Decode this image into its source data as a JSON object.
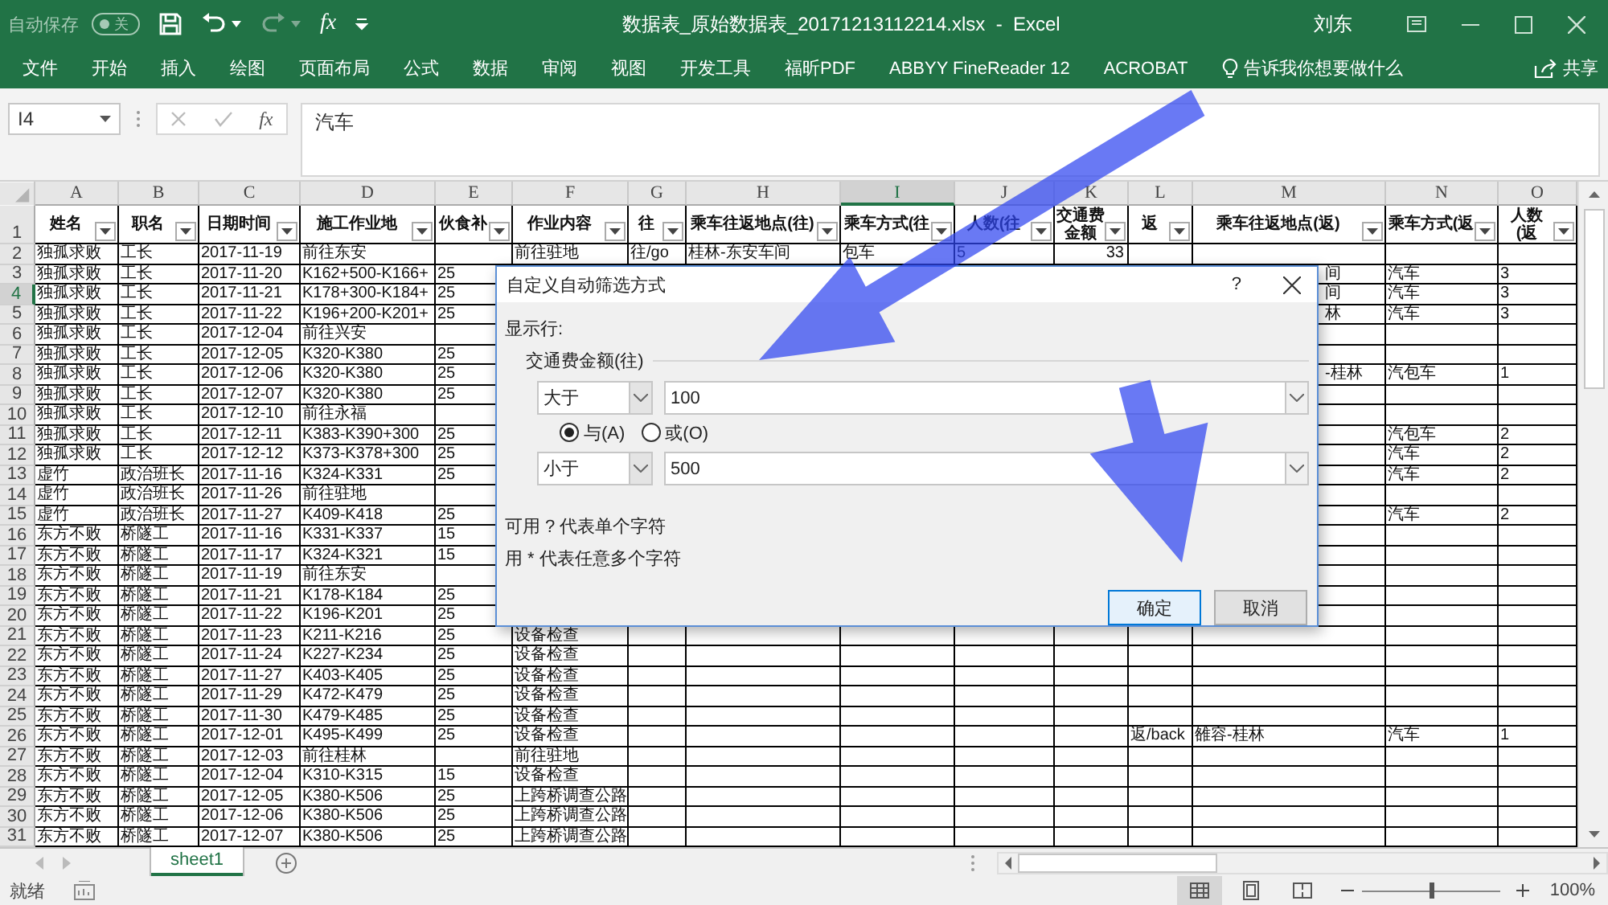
{
  "title_bar": {
    "autosave_label": "自动保存",
    "autosave_toggle": {
      "label": "关",
      "on": false
    },
    "function_symbol": "fx",
    "document_title": "数据表_原始数据表_20171213112214.xlsx  -  Excel",
    "user": "刘东"
  },
  "ribbon_tabs": [
    {
      "label": "文件",
      "selected": false
    },
    {
      "label": "开始",
      "selected": false
    },
    {
      "label": "插入",
      "selected": false
    },
    {
      "label": "绘图",
      "selected": false
    },
    {
      "label": "页面布局",
      "selected": false
    },
    {
      "label": "公式",
      "selected": false
    },
    {
      "label": "数据",
      "selected": false
    },
    {
      "label": "审阅",
      "selected": false
    },
    {
      "label": "视图",
      "selected": false
    },
    {
      "label": "开发工具",
      "selected": false
    },
    {
      "label": "福昕PDF",
      "selected": false
    },
    {
      "label": "ABBYY FineReader 12",
      "selected": false
    },
    {
      "label": "ACROBAT",
      "selected": false
    }
  ],
  "tell_me": "告诉我你想要做什么",
  "share": "共享",
  "formula_bar": {
    "name_box": "I4",
    "function_symbol": "fx",
    "value": "汽车"
  },
  "columns": [
    {
      "label": "A",
      "selected": false
    },
    {
      "label": "B",
      "selected": false
    },
    {
      "label": "C",
      "selected": false
    },
    {
      "label": "D",
      "selected": false
    },
    {
      "label": "E",
      "selected": false
    },
    {
      "label": "F",
      "selected": false
    },
    {
      "label": "G",
      "selected": false
    },
    {
      "label": "H",
      "selected": false
    },
    {
      "label": "I",
      "selected": true
    },
    {
      "label": "J",
      "selected": false
    },
    {
      "label": "K",
      "selected": false
    },
    {
      "label": "L",
      "selected": false
    },
    {
      "label": "M",
      "selected": false
    },
    {
      "label": "N",
      "selected": false
    },
    {
      "label": "O",
      "selected": false
    }
  ],
  "header_row": {
    "row": "1",
    "selected": false,
    "cells": {
      "A": "姓名",
      "B": "职名",
      "C": "日期时间",
      "D": "施工作业地",
      "E": "伙食补",
      "F": "作业内容",
      "G": "往",
      "H": "乘车往返地点(往)",
      "I": "乘车方式(往",
      "J": "人数(往",
      "K": "交通费金额",
      "L": "返",
      "M": "乘车往返地点(返)",
      "N": "乘车方式(返",
      "O": "人数(返"
    }
  },
  "rows": [
    {
      "row": "2",
      "selected": false,
      "cells": {
        "A": "独孤求败",
        "B": "工长",
        "C": "2017-11-19",
        "D": "前往东安",
        "F": "前往驻地",
        "G": "往/go",
        "H": "桂林-东安车间",
        "I": "包车",
        "J": "5",
        "K": "33"
      }
    },
    {
      "row": "3",
      "selected": false,
      "cells": {
        "A": "独孤求败",
        "B": "工长",
        "C": "2017-11-20",
        "D": "K162+500-K166+",
        "E": "25",
        "M": {
          "text": "间",
          "cut": true
        },
        "N": "汽车",
        "O": "3"
      }
    },
    {
      "row": "4",
      "selected": true,
      "cells": {
        "A": "独孤求败",
        "B": "工长",
        "C": "2017-11-21",
        "D": "K178+300-K184+",
        "E": "25",
        "M": {
          "text": "间",
          "cut": true
        },
        "N": "汽车",
        "O": "3"
      }
    },
    {
      "row": "5",
      "selected": false,
      "cells": {
        "A": "独孤求败",
        "B": "工长",
        "C": "2017-11-22",
        "D": "K196+200-K201+",
        "E": "25",
        "M": {
          "text": "林",
          "cut": true
        },
        "N": "汽车",
        "O": "3"
      }
    },
    {
      "row": "6",
      "selected": false,
      "cells": {
        "A": "独孤求败",
        "B": "工长",
        "C": "2017-12-04",
        "D": "前往兴安"
      }
    },
    {
      "row": "7",
      "selected": false,
      "cells": {
        "A": "独孤求败",
        "B": "工长",
        "C": "2017-12-05",
        "D": "K320-K380",
        "E": "25"
      }
    },
    {
      "row": "8",
      "selected": false,
      "cells": {
        "A": "独孤求败",
        "B": "工长",
        "C": "2017-12-06",
        "D": "K320-K380",
        "E": "25",
        "M": {
          "text": "-桂林",
          "cut": true
        },
        "N": "汽包车",
        "O": "1"
      }
    },
    {
      "row": "9",
      "selected": false,
      "cells": {
        "A": "独孤求败",
        "B": "工长",
        "C": "2017-12-07",
        "D": "K320-K380",
        "E": "25"
      }
    },
    {
      "row": "10",
      "selected": false,
      "cells": {
        "A": "独孤求败",
        "B": "工长",
        "C": "2017-12-10",
        "D": "前往永福"
      }
    },
    {
      "row": "11",
      "selected": false,
      "cells": {
        "A": "独孤求败",
        "B": "工长",
        "C": "2017-12-11",
        "D": "K383-K390+300",
        "E": "25",
        "N": "汽包车",
        "O": "2"
      }
    },
    {
      "row": "12",
      "selected": false,
      "cells": {
        "A": "独孤求败",
        "B": "工长",
        "C": "2017-12-12",
        "D": "K373-K378+300",
        "E": "25",
        "N": "汽车",
        "O": "2"
      }
    },
    {
      "row": "13",
      "selected": false,
      "cells": {
        "A": "虚竹",
        "B": "政治班长",
        "C": "2017-11-16",
        "D": "K324-K331",
        "E": "25",
        "N": "汽车",
        "O": "2"
      }
    },
    {
      "row": "14",
      "selected": false,
      "cells": {
        "A": "虚竹",
        "B": "政治班长",
        "C": "2017-11-26",
        "D": "前往驻地"
      }
    },
    {
      "row": "15",
      "selected": false,
      "cells": {
        "A": "虚竹",
        "B": "政治班长",
        "C": "2017-11-27",
        "D": "K409-K418",
        "E": "25",
        "N": "汽车",
        "O": "2"
      }
    },
    {
      "row": "16",
      "selected": false,
      "cells": {
        "A": "东方不败",
        "B": "桥隧工",
        "C": "2017-11-16",
        "D": "K331-K337",
        "E": "15"
      }
    },
    {
      "row": "17",
      "selected": false,
      "cells": {
        "A": "东方不败",
        "B": "桥隧工",
        "C": "2017-11-17",
        "D": "K324-K321",
        "E": "15"
      }
    },
    {
      "row": "18",
      "selected": false,
      "cells": {
        "A": "东方不败",
        "B": "桥隧工",
        "C": "2017-11-19",
        "D": "前往东安"
      }
    },
    {
      "row": "19",
      "selected": false,
      "cells": {
        "A": "东方不败",
        "B": "桥隧工",
        "C": "2017-11-21",
        "D": "K178-K184",
        "E": "25"
      }
    },
    {
      "row": "20",
      "selected": false,
      "cells": {
        "A": "东方不败",
        "B": "桥隧工",
        "C": "2017-11-22",
        "D": "K196-K201",
        "E": "25"
      }
    },
    {
      "row": "21",
      "selected": false,
      "cells": {
        "A": "东方不败",
        "B": "桥隧工",
        "C": "2017-11-23",
        "D": "K211-K216",
        "E": "25",
        "F": "设备检查"
      }
    },
    {
      "row": "22",
      "selected": false,
      "cells": {
        "A": "东方不败",
        "B": "桥隧工",
        "C": "2017-11-24",
        "D": "K227-K234",
        "E": "25",
        "F": "设备检查"
      }
    },
    {
      "row": "23",
      "selected": false,
      "cells": {
        "A": "东方不败",
        "B": "桥隧工",
        "C": "2017-11-27",
        "D": "K403-K405",
        "E": "25",
        "F": "设备检查"
      }
    },
    {
      "row": "24",
      "selected": false,
      "cells": {
        "A": "东方不败",
        "B": "桥隧工",
        "C": "2017-11-29",
        "D": "K472-K479",
        "E": "25",
        "F": "设备检查"
      }
    },
    {
      "row": "25",
      "selected": false,
      "cells": {
        "A": "东方不败",
        "B": "桥隧工",
        "C": "2017-11-30",
        "D": "K479-K485",
        "E": "25",
        "F": "设备检查"
      }
    },
    {
      "row": "26",
      "selected": false,
      "cells": {
        "A": "东方不败",
        "B": "桥隧工",
        "C": "2017-12-01",
        "D": "K495-K499",
        "E": "25",
        "F": "设备检查",
        "L": "返/back",
        "M": "雒容-桂林",
        "N": "汽车",
        "O": "1"
      }
    },
    {
      "row": "27",
      "selected": false,
      "cells": {
        "A": "东方不败",
        "B": "桥隧工",
        "C": "2017-12-03",
        "D": "前往桂林",
        "F": "前往驻地"
      }
    },
    {
      "row": "28",
      "selected": false,
      "cells": {
        "A": "东方不败",
        "B": "桥隧工",
        "C": "2017-12-04",
        "D": "K310-K315",
        "E": "15",
        "F": "设备检查"
      }
    },
    {
      "row": "29",
      "selected": false,
      "cells": {
        "A": "东方不败",
        "B": "桥隧工",
        "C": "2017-12-05",
        "D": "K380-K506",
        "E": "25",
        "F": "上跨桥调查公路"
      }
    },
    {
      "row": "30",
      "selected": false,
      "cells": {
        "A": "东方不败",
        "B": "桥隧工",
        "C": "2017-12-06",
        "D": "K380-K506",
        "E": "25",
        "F": "上跨桥调查公路"
      }
    },
    {
      "row": "31",
      "selected": false,
      "cells": {
        "A": "东方不败",
        "B": "桥隧工",
        "C": "2017-12-07",
        "D": "K380-K506",
        "E": "25",
        "F": "上跨桥调查公路"
      }
    }
  ],
  "sheet_tabs": [
    {
      "label": "sheet1",
      "selected": true
    }
  ],
  "dialog": {
    "title": "自定义自动筛选方式",
    "help": "?",
    "show_rows_label": "显示行:",
    "field_label": "交通费金额(往)",
    "conditions": [
      {
        "operator": "大于",
        "value": "100"
      },
      {
        "operator": "小于",
        "value": "500"
      }
    ],
    "logic": [
      {
        "label": "与(A)",
        "selected": true
      },
      {
        "label": "或(O)",
        "selected": false
      }
    ],
    "hints": [
      "可用 ? 代表单个字符",
      "用 * 代表任意多个字符"
    ],
    "buttons": [
      {
        "label": "确定",
        "default": true
      },
      {
        "label": "取消",
        "default": false
      }
    ]
  },
  "status_bar": {
    "status": "就绪",
    "zoom": {
      "level": 0.5
    },
    "zoom_label": "100%"
  }
}
